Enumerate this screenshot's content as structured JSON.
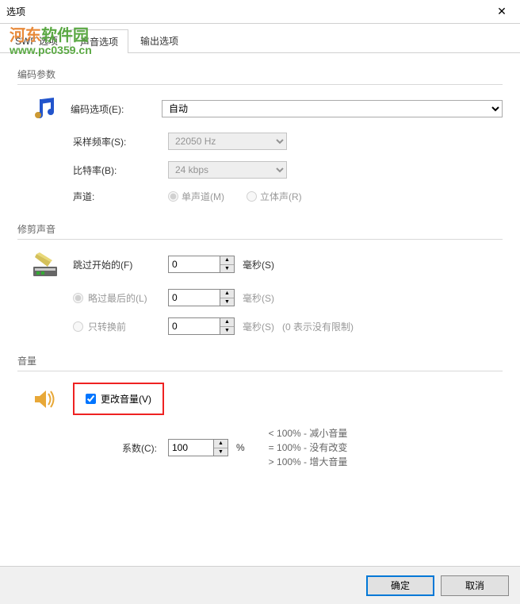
{
  "window": {
    "title": "选项"
  },
  "watermark": {
    "text1a": "河东",
    "text1b": "软件园",
    "url": "www.pc0359.cn"
  },
  "tabs": {
    "t1": "SWF 选项",
    "t2": "声音选项",
    "t3": "输出选项"
  },
  "sections": {
    "encoding": "编码参数",
    "trim": "修剪声音",
    "volume": "音量"
  },
  "encoding": {
    "options_label": "编码选项(E):",
    "options_value": "自动",
    "samplerate_label": "采样频率(S):",
    "samplerate_value": "22050 Hz",
    "bitrate_label": "比特率(B):",
    "bitrate_value": "24 kbps",
    "channel_label": "声道:",
    "mono": "单声道(M)",
    "stereo": "立体声(R)"
  },
  "trim": {
    "skip_first_label": "跳过开始的(F)",
    "skip_first_value": "0",
    "ms1": "毫秒(S)",
    "skip_last_label": "略过最后的(L)",
    "skip_last_value": "0",
    "ms2": "毫秒(S)",
    "convert_only_label": "只转换前",
    "convert_only_value": "0",
    "ms3": "毫秒(S)",
    "hint": "(0 表示没有限制)"
  },
  "volume": {
    "change_label": "更改音量(V)",
    "coef_label": "系数(C):",
    "coef_value": "100",
    "percent": "%",
    "hint": "< 100% - 减小音量\n= 100% - 没有改变\n> 100% - 增大音量"
  },
  "buttons": {
    "ok": "确定",
    "cancel": "取消"
  }
}
